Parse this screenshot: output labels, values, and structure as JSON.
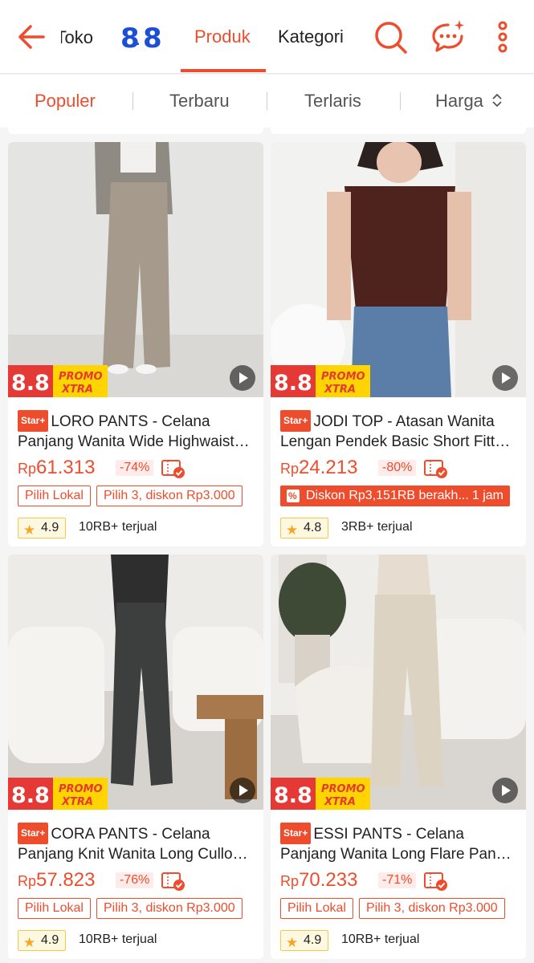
{
  "header": {
    "store_name": "Toko",
    "tabs": [
      "Produk",
      "Kategori"
    ],
    "active_tab": "Produk",
    "icons": [
      "back-arrow-icon",
      "search-icon",
      "chat-icon",
      "more-icon"
    ]
  },
  "sort": {
    "items": [
      "Populer",
      "Terbaru",
      "Terlaris",
      "Harga"
    ],
    "active": "Populer"
  },
  "promo_badge": {
    "main": "8.8",
    "line1": "PROMO",
    "line2": "XTRA"
  },
  "products": [
    {
      "tag": "Star+",
      "title": "LORO PANTS - Celana Panjang Wanita Wide Highwaist…",
      "currency": "Rp",
      "price": "61.313",
      "discount": "-74%",
      "chips": [
        "Pilih Lokal",
        "Pilih 3, diskon Rp3.000"
      ],
      "rating": "4.9",
      "sold": "10RB+ terjual"
    },
    {
      "tag": "Star+",
      "title": "JODI TOP - Atasan Wanita Lengan Pendek Basic Short Fitt…",
      "currency": "Rp",
      "price": "24.213",
      "discount": "-80%",
      "promo_bar": "Diskon Rp3,151RB berakh...",
      "promo_time": "1 jam",
      "rating": "4.8",
      "sold": "3RB+ terjual"
    },
    {
      "tag": "Star+",
      "title": "CORA PANTS - Celana Panjang Knit Wanita Long Cullo…",
      "currency": "Rp",
      "price": "57.823",
      "discount": "-76%",
      "chips": [
        "Pilih Lokal",
        "Pilih 3, diskon Rp3.000"
      ],
      "rating": "4.9",
      "sold": "10RB+ terjual"
    },
    {
      "tag": "Star+",
      "title": "ESSI PANTS - Celana Panjang Wanita Long Flare Pan…",
      "currency": "Rp",
      "price": "70.233",
      "discount": "-71%",
      "chips": [
        "Pilih Lokal",
        "Pilih 3, diskon Rp3.000"
      ],
      "rating": "4.9",
      "sold": "10RB+ terjual"
    }
  ],
  "colors": {
    "accent": "#ee4d2d",
    "rating_border": "#f2c94c",
    "star": "#f5a623"
  }
}
